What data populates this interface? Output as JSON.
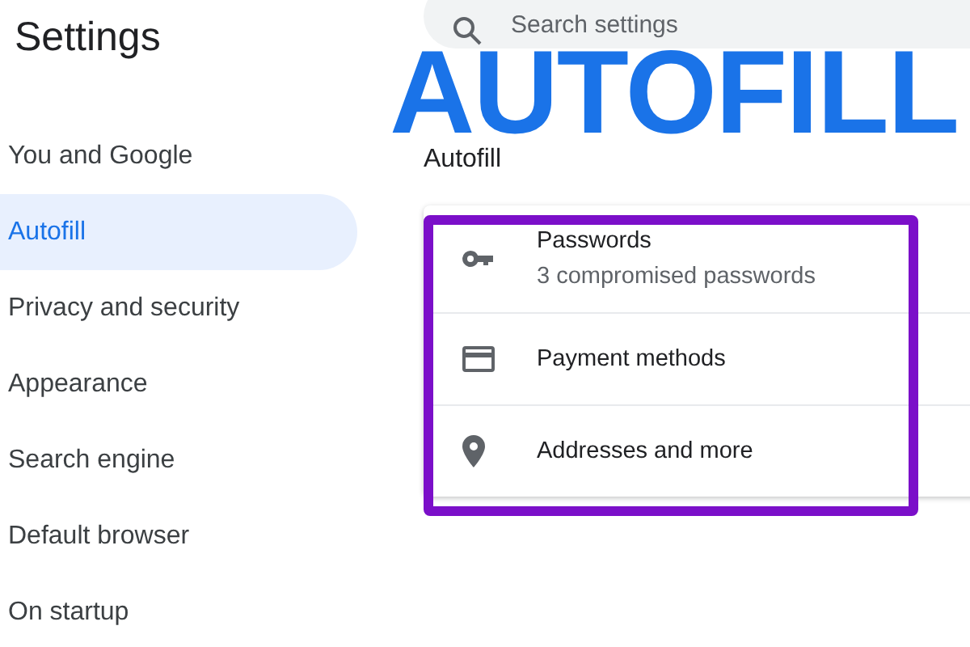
{
  "sidebar": {
    "title": "Settings",
    "items": [
      {
        "label": "You and Google",
        "selected": false
      },
      {
        "label": "Autofill",
        "selected": true
      },
      {
        "label": "Privacy and security",
        "selected": false
      },
      {
        "label": "Appearance",
        "selected": false
      },
      {
        "label": "Search engine",
        "selected": false
      },
      {
        "label": "Default browser",
        "selected": false
      },
      {
        "label": "On startup",
        "selected": false
      }
    ]
  },
  "search": {
    "placeholder": "Search settings"
  },
  "banner": "AUTOFILL",
  "section": {
    "title": "Autofill",
    "rows": [
      {
        "title": "Passwords",
        "subtitle": "3 compromised passwords"
      },
      {
        "title": "Payment methods"
      },
      {
        "title": "Addresses and more"
      }
    ]
  }
}
